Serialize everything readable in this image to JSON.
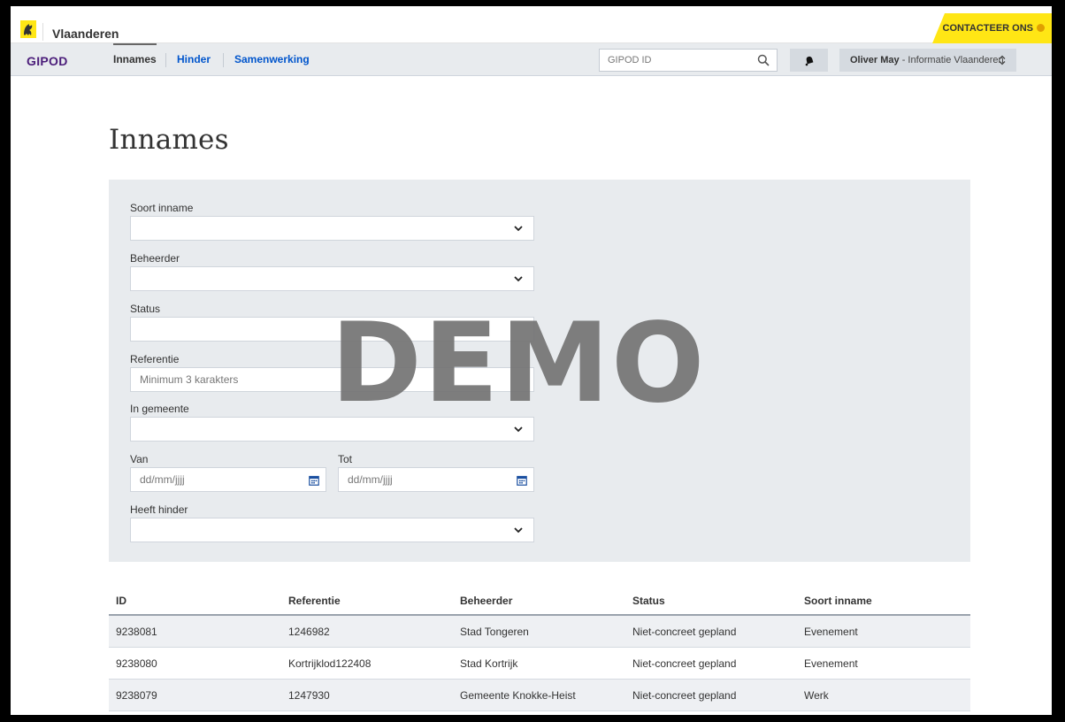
{
  "brand": {
    "name": "Vlaanderen",
    "contact_label": "CONTACTEER ONS"
  },
  "app": {
    "name": "GIPOD"
  },
  "nav": {
    "items": [
      {
        "label": "Innames",
        "active": true
      },
      {
        "label": "Hinder",
        "active": false
      },
      {
        "label": "Samenwerking",
        "active": false
      }
    ]
  },
  "search": {
    "placeholder": "GIPOD ID"
  },
  "user": {
    "name": "Oliver May",
    "org": " - Informatie Vlaanderen"
  },
  "page": {
    "title": "Innames"
  },
  "filters": {
    "soort_inname": {
      "label": "Soort inname",
      "value": ""
    },
    "beheerder": {
      "label": "Beheerder",
      "value": ""
    },
    "status": {
      "label": "Status",
      "value": ""
    },
    "referentie": {
      "label": "Referentie",
      "placeholder": "Minimum 3 karakters"
    },
    "gemeente": {
      "label": "In gemeente",
      "value": ""
    },
    "van": {
      "label": "Van",
      "placeholder": "dd/mm/jjjj"
    },
    "tot": {
      "label": "Tot",
      "placeholder": "dd/mm/jjjj"
    },
    "hinder": {
      "label": "Heeft hinder",
      "value": ""
    }
  },
  "watermark": "DEMO",
  "table": {
    "columns": [
      "ID",
      "Referentie",
      "Beheerder",
      "Status",
      "Soort inname"
    ],
    "rows": [
      [
        "9238081",
        "1246982",
        "Stad Tongeren",
        "Niet-concreet gepland",
        "Evenement"
      ],
      [
        "9238080",
        "Kortrijklod122408",
        "Stad Kortrijk",
        "Niet-concreet gepland",
        "Evenement"
      ],
      [
        "9238079",
        "1247930",
        "Gemeente Knokke-Heist",
        "Niet-concreet gepland",
        "Werk"
      ]
    ]
  },
  "colors": {
    "accent_yellow": "#ffe615",
    "app_purple": "#4b1d7a",
    "link_blue": "#0055cc",
    "panel_gray": "#e8ebee"
  }
}
